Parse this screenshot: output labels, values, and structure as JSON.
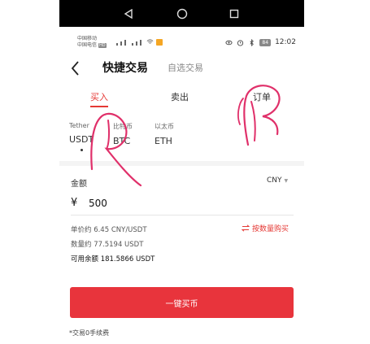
{
  "status_bar": {
    "carrier_1": "中国移动",
    "carrier_2": "中国电信",
    "carrier_2_badge": "HD",
    "battery": "84",
    "time": "12:02"
  },
  "header": {
    "title": "快捷交易",
    "alt_tab": "自选交易"
  },
  "tabs": {
    "buy": "买入",
    "sell": "卖出",
    "order": "订单",
    "active": "buy"
  },
  "coins": {
    "usdt": {
      "name": "Tether",
      "symbol": "USDT",
      "selected": true
    },
    "btc": {
      "name": "比特币",
      "symbol": "BTC"
    },
    "eth": {
      "name": "以太币",
      "symbol": "ETH"
    }
  },
  "amount": {
    "label": "金额",
    "currency": "CNY",
    "symbol": "¥",
    "value": "500"
  },
  "info": {
    "unit_price": "单价约 6.45 CNY/USDT",
    "quantity": "数量约 77.5194 USDT",
    "balance": "可用余额 181.5866 USDT",
    "buy_by_quantity": "按数量购买"
  },
  "actions": {
    "buy_button": "一键买币"
  },
  "footer": {
    "fee_note": "*交易0手续费"
  },
  "colors": {
    "accent": "#e53935",
    "button": "#e8343c",
    "navbar": "#000000"
  }
}
